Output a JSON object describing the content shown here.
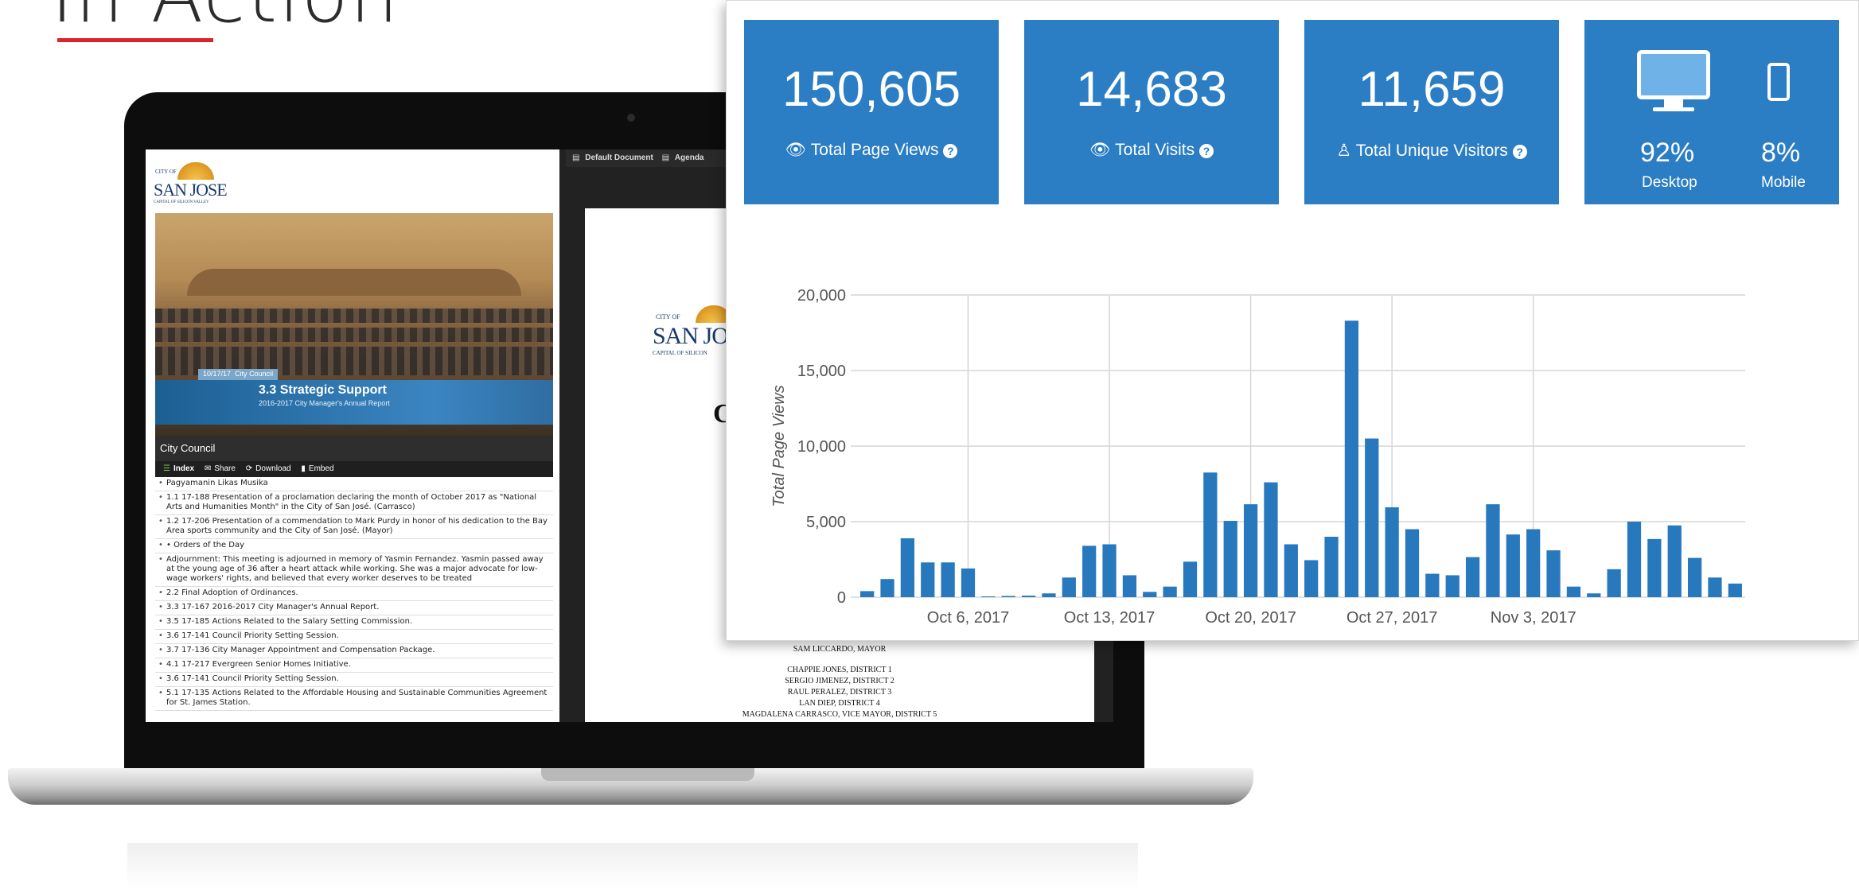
{
  "slide": {
    "title": "In Action"
  },
  "player": {
    "logo_top": "CITY OF",
    "logo_main": "SAN JOSE",
    "logo_sub": "CAPITAL OF SILICON VALLEY",
    "video_date": "10/17/17",
    "video_body": "City Council",
    "video_title": "3.3  Strategic Support",
    "video_subtitle": "2016-2017 City Manager's Annual Report",
    "meeting_name": "City Council",
    "tabs": [
      "Index",
      "Share",
      "Download",
      "Embed"
    ],
    "agenda": [
      "Pagyamanin Likas Musika",
      "1.1 17-188 Presentation of a proclamation declaring the month of October 2017 as \"National Arts and Humanities Month\" in the City of San José. (Carrasco)",
      "1.2 17-206 Presentation of a commendation to Mark Purdy in honor of his dedication to the Bay Area sports community and the City of San José. (Mayor)",
      "• Orders of the Day",
      "Adjournment: This meeting is adjourned in memory of Yasmin Fernandez. Yasmin passed away at the young age of 36 after a heart attack while working. She was a major advocate for low-wage workers' rights, and believed that every worker deserves to be treated",
      "2.2 Final Adoption of Ordinances.",
      "3.3 17-167 2016-2017 City Manager's Annual Report.",
      "3.5 17-185 Actions Related to the Salary Setting Commission.",
      "3.6 17-141 Council Priority Setting Session.",
      "3.7 17-136 City Manager Appointment and Compensation Package.",
      "4.1 17-217 Evergreen Senior Homes Initiative.",
      "3.6 17-141 Council Priority Setting Session.",
      "5.1 17-135 Actions Related to the Affordable Housing and Sustainable Communities Agreement for St. James Station."
    ]
  },
  "document": {
    "toolbar": [
      "Default Document",
      "Agenda"
    ],
    "logo_main": "SAN JO",
    "logo_top": "CITY OF",
    "logo_sub": "CAPITAL OF SILICON",
    "heading_fragment": "C",
    "names": [
      "SAM LICCARDO, MAYOR",
      "",
      "CHAPPIE JONES, DISTRICT 1",
      "SERGIO JIMENEZ, DISTRICT 2",
      "RAUL PERALEZ, DISTRICT 3",
      "LAN DIEP, DISTRICT 4",
      "MAGDALENA CARRASCO, VICE MAYOR, DISTRICT 5"
    ]
  },
  "stats": {
    "page_views": {
      "value": "150,605",
      "label": "Total Page Views",
      "icon": "eye-icon"
    },
    "visits": {
      "value": "14,683",
      "label": "Total Visits",
      "icon": "eye-icon"
    },
    "unique_visitors": {
      "value": "11,659",
      "label": "Total Unique Visitors",
      "icon": "user-icon"
    },
    "devices": {
      "desktop_pct": "92%",
      "desktop_label": "Desktop",
      "mobile_pct": "8%",
      "mobile_label": "Mobile"
    }
  },
  "colors": {
    "accent": "#d9232d",
    "stat_blue": "#2b7dc4",
    "bar_blue": "#2878be"
  },
  "chart_data": {
    "type": "bar",
    "ylabel": "Total Page Views",
    "ylim": [
      0,
      20000
    ],
    "y_ticks": [
      "0",
      "5,000",
      "10,000",
      "15,000",
      "20,000"
    ],
    "x_tick_labels": [
      "Oct 6, 2017",
      "Oct 13, 2017",
      "Oct 20, 2017",
      "Oct 27, 2017",
      "Nov 3, 2017"
    ],
    "x_tick_days": [
      6,
      13,
      20,
      27,
      34
    ],
    "first_day": 1,
    "grid": true,
    "values": [
      400,
      1200,
      3900,
      2300,
      2300,
      1900,
      50,
      80,
      100,
      250,
      1300,
      3400,
      3500,
      1450,
      350,
      700,
      2350,
      8250,
      5050,
      6150,
      7600,
      3500,
      2450,
      4000,
      18300,
      10500,
      5950,
      4500,
      1550,
      1450,
      2650,
      6150,
      4150,
      4500,
      3100,
      700,
      250,
      1850,
      5000,
      3850,
      4750,
      2600,
      1300,
      900
    ]
  }
}
